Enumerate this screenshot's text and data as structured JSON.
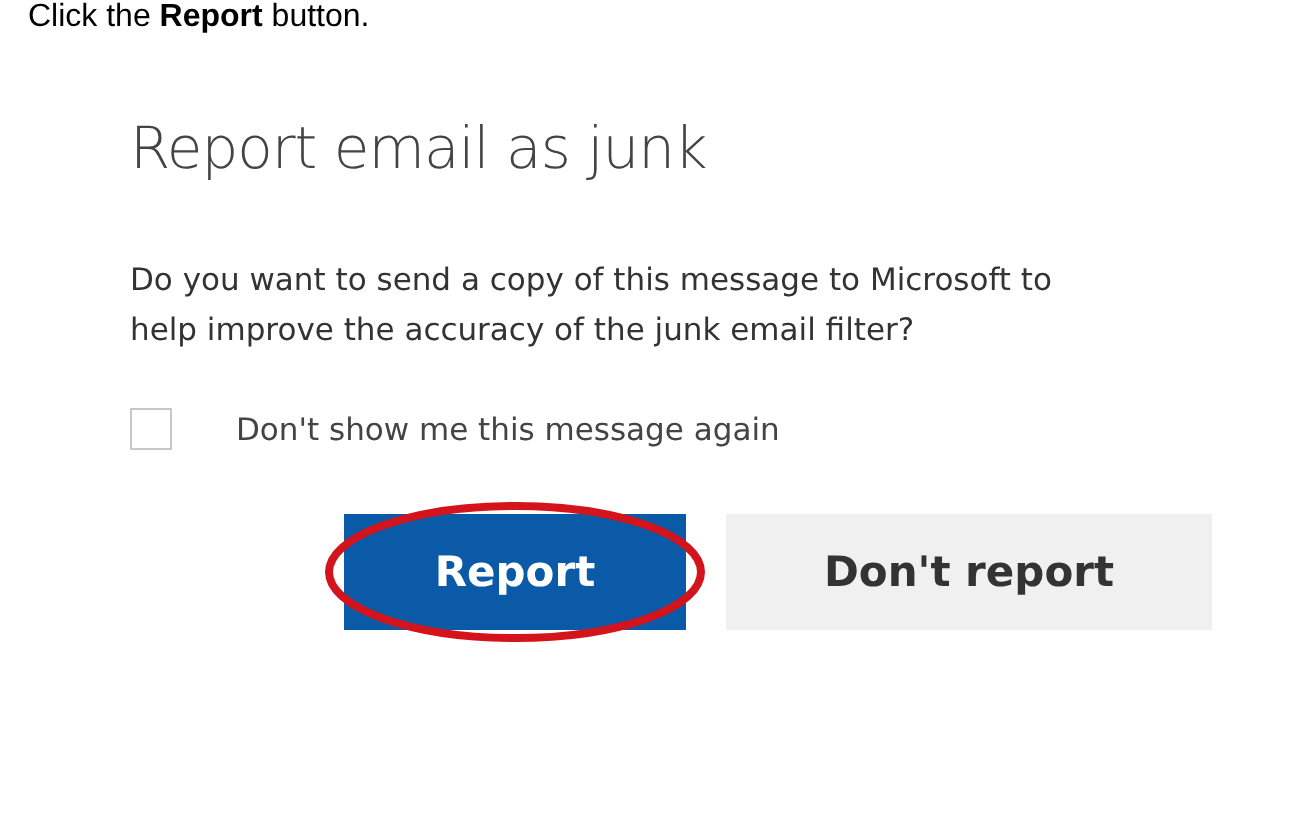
{
  "instruction": "Click the **Report** button.",
  "dialog": {
    "title": "Report email as junk",
    "message": "Do you want to send a copy of this message to Microsoft to help improve the accuracy of the junk email filter?",
    "checkbox": {
      "label": "Don't show me this message again",
      "checked": false
    },
    "buttons": [
      {
        "label": "Report",
        "kind": "primary",
        "highlighted": true
      },
      {
        "label": "Don't report",
        "kind": "secondary",
        "highlighted": false
      }
    ]
  }
}
